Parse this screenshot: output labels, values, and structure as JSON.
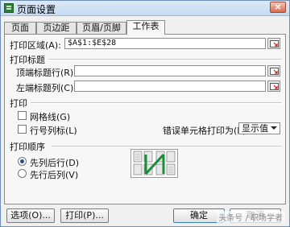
{
  "window": {
    "title": "页面设置",
    "close": "×"
  },
  "tabs": [
    {
      "label": "页面"
    },
    {
      "label": "页边距"
    },
    {
      "label": "页眉/页脚"
    },
    {
      "label": "工作表"
    }
  ],
  "print_area": {
    "label": "打印区域(A):",
    "value": "$A$1:$E$28"
  },
  "print_titles": {
    "section": "打印标题",
    "top_rows": {
      "label": "顶端标题行(R):",
      "value": ""
    },
    "left_cols": {
      "label": "左端标题列(C):",
      "value": ""
    }
  },
  "print": {
    "section": "打印",
    "gridlines": {
      "label": "网格线(G)",
      "checked": false
    },
    "row_col_headers": {
      "label": "行号列标(L)",
      "checked": false
    },
    "cell_errors": {
      "label": "错误单元格打印为(E):",
      "selected": "显示值"
    }
  },
  "page_order": {
    "section": "打印顺序",
    "options": [
      {
        "label": "先列后行(D)",
        "selected": true
      },
      {
        "label": "先行后列(V)",
        "selected": false
      }
    ]
  },
  "buttons": {
    "options": "选项(O)...",
    "print": "打印(P)...",
    "ok": "确定",
    "cancel": "取消"
  },
  "watermark": "头条号 / 职场学者",
  "colors": {
    "accent": "#1f4d9a",
    "order_arrow": "#1a8f3a"
  }
}
